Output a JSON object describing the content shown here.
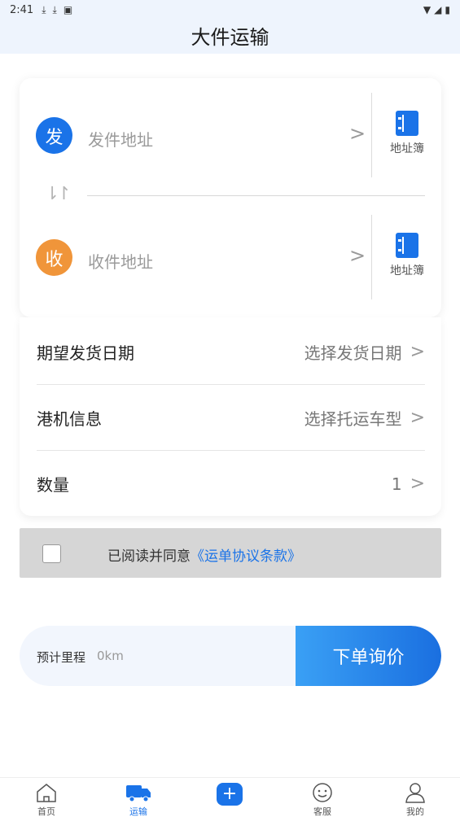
{
  "status_bar": {
    "time": "2:41"
  },
  "header": {
    "title": "大件运输"
  },
  "address": {
    "sender": {
      "badge": "发",
      "placeholder": "发件地址",
      "badge_color": "#1a73e8"
    },
    "receiver": {
      "badge": "收",
      "placeholder": "收件地址",
      "badge_color": "#f0953a"
    },
    "book_label": "地址簿"
  },
  "options": [
    {
      "label": "期望发货日期",
      "value": "选择发货日期"
    },
    {
      "label": "港机信息",
      "value": "选择托运车型"
    },
    {
      "label": "数量",
      "value": "1"
    }
  ],
  "agreement": {
    "text": "已阅读并同意",
    "link": "《运单协议条款》",
    "checked": false
  },
  "order": {
    "estimate_label": "预计里程",
    "estimate_value": "0km",
    "submit_label": "下单询价"
  },
  "tabs": [
    {
      "label": "首页",
      "icon": "home-icon"
    },
    {
      "label": "运输",
      "icon": "truck-icon",
      "active": true
    },
    {
      "label": "",
      "icon": "plus-icon"
    },
    {
      "label": "客服",
      "icon": "smile-icon"
    },
    {
      "label": "我的",
      "icon": "user-icon"
    }
  ],
  "colors": {
    "accent": "#1a73e8",
    "header_bg": "#eef4fd"
  }
}
